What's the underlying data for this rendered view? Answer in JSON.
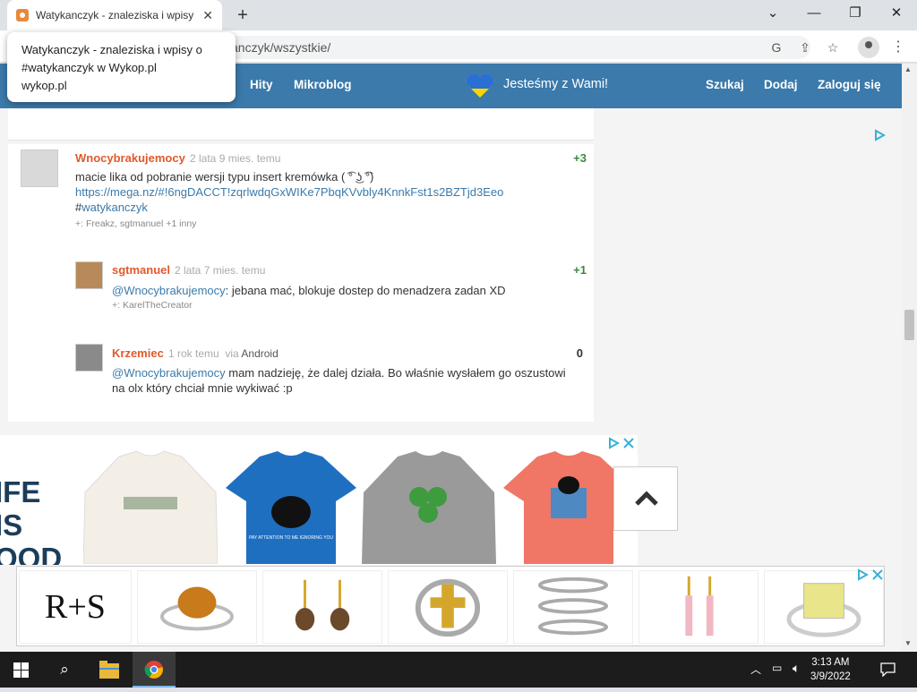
{
  "browser": {
    "tab_title": "Watykanczyk - znaleziska i wpisy",
    "url": "wykop.pl/tag/watykanczyk/wszystkie/",
    "url_visible": "anczyk/wszystkie/",
    "tooltip": {
      "title_line1": "Watykanczyk - znaleziska i wpisy o",
      "title_line2": "#watykanczyk w Wykop.pl",
      "domain": "wykop.pl"
    }
  },
  "navbar": {
    "items": [
      "Hity",
      "Mikroblog"
    ],
    "ukraine_text": "Jesteśmy z Wami!",
    "right_items": [
      "Szukaj",
      "Dodaj",
      "Zaloguj się"
    ]
  },
  "entry": {
    "author": "Wnocybrakujemocy",
    "time": "2 lata 9 mies. temu",
    "score": "+3",
    "text": "macie lika od pobranie wersji typu insert kremówka ( ͡° ͜ʖ ͡°)",
    "link": "https://mega.nz/#!6ngDACCT!zqrlwdqGxWIKe7PbqKVvbly4KnnkFst1s2BZTjd3Eeo",
    "tag_hash": "#",
    "tag": "watykanczyk",
    "plus_label": "+: Freakz, sgtmanuel +1 inny"
  },
  "comments": [
    {
      "author": "sgtmanuel",
      "time": "2 lata 7 mies. temu",
      "score": "+1",
      "mention": "@Wnocybrakujemocy",
      "text": ": jebana mać, blokuje dostep do menadzera zadan XD",
      "plus_label": "+: KarelTheCreator"
    },
    {
      "author": "Krzemiec",
      "time": "1 rok temu",
      "via": "via",
      "device": "Android",
      "score": "0",
      "mention": "@Wnocybrakujemocy",
      "text_line1": " mam nadzieję, że dalej działa. Bo właśnie wysłałem go oszustowi",
      "text_line2": "na olx który chciał mnie wykiwać :p"
    }
  ],
  "ad1": {
    "brand_lines": [
      "IFE",
      "IS",
      "OOD"
    ],
    "shirt_text": "PAY ATTENTION TO ME IGNORING YOU"
  },
  "ad2": {
    "brand": "R+S"
  },
  "taskbar": {
    "time": "3:13 AM",
    "date": "3/9/2022"
  },
  "colors": {
    "navbar": "#3b7aab",
    "author": "#e05a2b",
    "score_positive": "#3a8a3a",
    "link": "#3b7aab"
  }
}
